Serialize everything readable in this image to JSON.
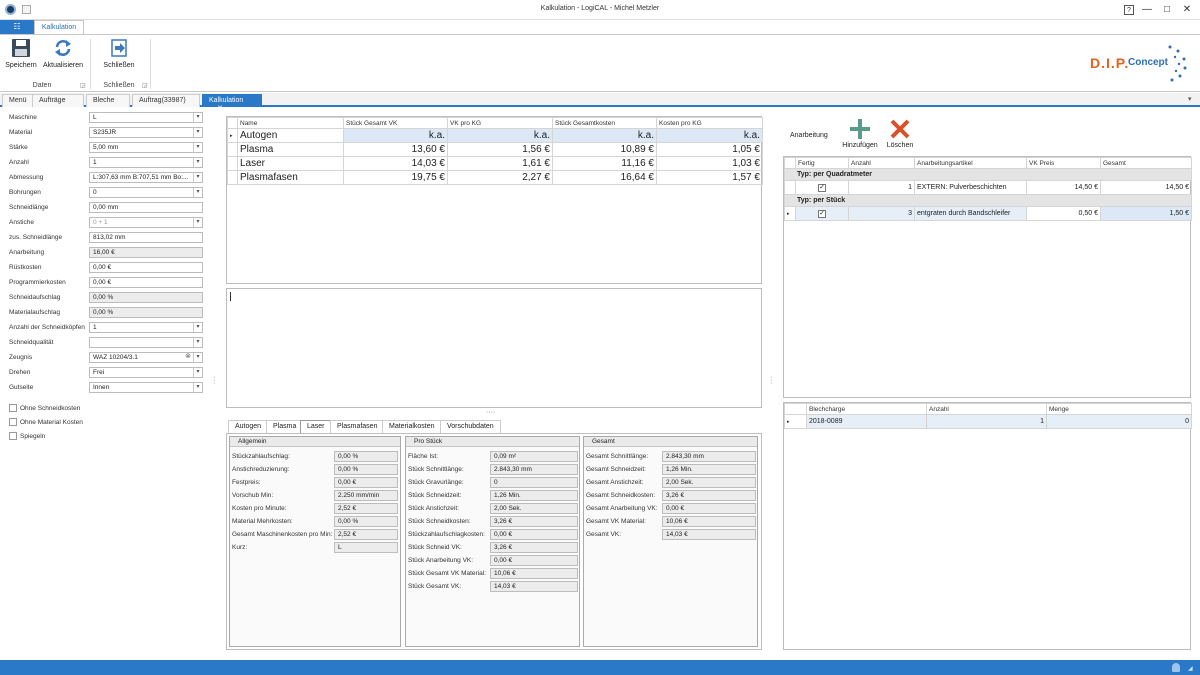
{
  "window": {
    "title": "Kalkulation - LogiCAL - Michel Metzler",
    "help": "?",
    "minimize": "—",
    "maximize": "□",
    "close": "✕"
  },
  "ribbon": {
    "file_tab": "☷",
    "active_tab": "Kalkulation",
    "buttons": {
      "save": "Speichern",
      "refresh": "Aktualisieren",
      "close": "Schließen"
    },
    "groups": {
      "daten": "Daten",
      "schliessen": "Schließen"
    }
  },
  "logo": {
    "dip": "D.I.P.",
    "concept": "Concept"
  },
  "doc_tabs": [
    "Menü",
    "Aufträge",
    "Bleche",
    "Auftrag(33987)",
    "Kalkulation"
  ],
  "doc_tab_close": "✕",
  "form": [
    {
      "label": "Maschine",
      "value": "L"
    },
    {
      "label": "Material",
      "value": "S235JR"
    },
    {
      "label": "Stärke",
      "value": "5,00 mm"
    },
    {
      "label": "Anzahl",
      "value": "1"
    },
    {
      "label": "Abmessung",
      "value": "L:307,63 mm B:707,51 mm Bo:..."
    },
    {
      "label": "Bohrungen",
      "value": "0"
    },
    {
      "label": "Schneidlänge",
      "value": "0,00 mm"
    },
    {
      "label": "Anstiche",
      "value": "0 + 1"
    },
    {
      "label": "zus. Schneidlänge",
      "value": "813,02 mm"
    },
    {
      "label": "Anarbeitung",
      "value": "16,00 €"
    },
    {
      "label": "Rüstkosten",
      "value": "0,00 €"
    },
    {
      "label": "Programmierkosten",
      "value": "0,00 €"
    },
    {
      "label": "Schneidaufschlag",
      "value": "0,00 %"
    },
    {
      "label": "Materialaufschlag",
      "value": "0,00 %"
    },
    {
      "label": "Anzahl der Schneidköpfen",
      "value": "1"
    },
    {
      "label": "Schneidqualität",
      "value": ""
    },
    {
      "label": "Zeugnis",
      "value": "WAZ 10204/3.1"
    },
    {
      "label": "Drehen",
      "value": "Frei"
    },
    {
      "label": "Gutseite",
      "value": "Innen"
    }
  ],
  "checkboxes": [
    "Ohne Schneidkosten",
    "Ohne Material Kosten",
    "Spiegeln"
  ],
  "cost_table": {
    "headers": [
      "Name",
      "Stück Gesamt VK",
      "VK pro KG",
      "Stück Gesamtkosten",
      "Kosten pro KG"
    ],
    "rows": [
      [
        "Autogen",
        "k.a.",
        "k.a.",
        "k.a.",
        "k.a."
      ],
      [
        "Plasma",
        "13,60 €",
        "1,56 €",
        "10,89 €",
        "1,05 €"
      ],
      [
        "Laser",
        "14,03 €",
        "1,61 €",
        "11,16 €",
        "1,03 €"
      ],
      [
        "Plasmafasen",
        "19,75 €",
        "2,27 €",
        "16,64 €",
        "1,57 €"
      ]
    ]
  },
  "anarbeitung": {
    "title": "Anarbeitung",
    "add": "Hinzufügen",
    "delete": "Löschen",
    "headers": [
      "Fertig",
      "Anzahl",
      "Anarbeitungsartikel",
      "VK Preis",
      "Gesamt"
    ],
    "groups": [
      {
        "name": "Typ: per Quadratmeter",
        "rows": [
          {
            "anzahl": "1",
            "artikel": "EXTERN: Pulverbeschichten",
            "vk": "14,50 €",
            "gesamt": "14,50 €"
          }
        ]
      },
      {
        "name": "Typ: per Stück",
        "rows": [
          {
            "anzahl": "3",
            "artikel": "entgraten durch Bandschleifer",
            "vk": "0,50 €",
            "gesamt": "1,50 €"
          }
        ]
      }
    ]
  },
  "blech": {
    "headers": [
      "Blechcharge",
      "Anzahl",
      "Menge"
    ],
    "rows": [
      [
        "2018-0089",
        "1",
        "0"
      ]
    ]
  },
  "detail_tabs": [
    "Autogen",
    "Plasma",
    "Laser",
    "Plasmafasen",
    "Materialkosten",
    "Vorschubdaten"
  ],
  "allgemein": {
    "title": "Allgemein",
    "rows": [
      {
        "label": "Stückzahlaufschlag:",
        "value": "0,00 %"
      },
      {
        "label": "Anstichreduzierung:",
        "value": "0,00 %"
      },
      {
        "label": "Festpreis:",
        "value": "0,00 €"
      },
      {
        "label": "Vorschub Min:",
        "value": "2.250 mm/min"
      },
      {
        "label": "Kosten pro Minute:",
        "value": "2,52 €"
      },
      {
        "label": "Material Mehrkosten:",
        "value": "0,00 %"
      },
      {
        "label": "Gesamt Maschinenkosten pro Min:",
        "value": "2,52 €"
      },
      {
        "label": "Kurz:",
        "value": "L"
      }
    ]
  },
  "pro_stueck": {
    "title": "Pro Stück",
    "rows": [
      {
        "label": "Fläche Ist:",
        "value": "0,09 m²"
      },
      {
        "label": "Stück Schnittlänge:",
        "value": "2.843,30 mm"
      },
      {
        "label": "Stück Gravurlänge:",
        "value": "0"
      },
      {
        "label": "Stück Schneidzeit:",
        "value": "1,26 Min."
      },
      {
        "label": "Stück Anstichzeit:",
        "value": "2,00 Sek."
      },
      {
        "label": "Stück Schneidkosten:",
        "value": "3,26 €"
      },
      {
        "label": "Stückzahlaufschlagkosten:",
        "value": "0,00 €"
      },
      {
        "label": "Stück Schneid VK:",
        "value": "3,26 €"
      },
      {
        "label": "Stück Anarbeitung VK:",
        "value": "0,00 €"
      },
      {
        "label": "Stück Gesamt VK Material:",
        "value": "10,06 €"
      },
      {
        "label": "Stück Gesamt VK:",
        "value": "14,03 €"
      }
    ]
  },
  "gesamt": {
    "title": "Gesamt",
    "rows": [
      {
        "label": "Gesamt Schnittlänge:",
        "value": "2.843,30 mm"
      },
      {
        "label": "Gesamt Schneidzeit:",
        "value": "1,26 Min."
      },
      {
        "label": "Gesamt Anstichzeit:",
        "value": "2,00 Sek."
      },
      {
        "label": "Gesamt Schneidkosten:",
        "value": "3,26 €"
      },
      {
        "label": "Gesamt Anarbeitung VK:",
        "value": "0,00 €"
      },
      {
        "label": "Gesamt VK Material:",
        "value": "10,06 €"
      },
      {
        "label": "Gesamt VK:",
        "value": "14,03 €"
      }
    ]
  },
  "colors": {
    "accent": "#2a78c8",
    "header_blue": "#2a6fb6",
    "logo_orange": "#e8601c",
    "add_green": "#5a9c8c",
    "delete_red": "#d9502a"
  }
}
